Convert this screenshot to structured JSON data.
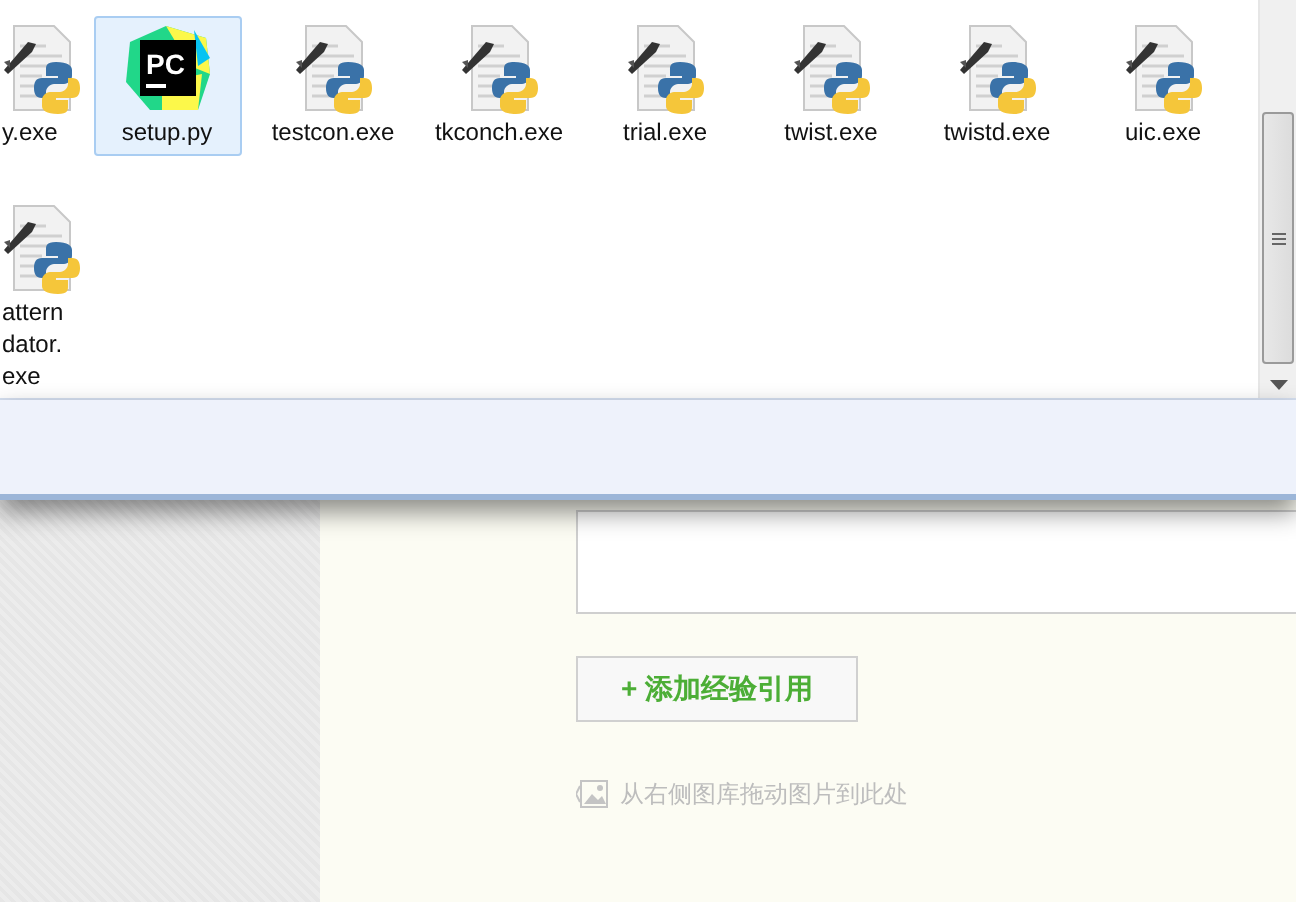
{
  "explorer": {
    "files": [
      {
        "name": "y.exe",
        "kind": "python-exe",
        "selected": false
      },
      {
        "name": "setup.py",
        "kind": "pycharm",
        "icon_text": "PC",
        "selected": true
      },
      {
        "name": "testcon.exe",
        "kind": "python-exe",
        "selected": false
      },
      {
        "name": "tkconch.exe",
        "kind": "python-exe",
        "selected": false
      },
      {
        "name": "trial.exe",
        "kind": "python-exe",
        "selected": false
      },
      {
        "name": "twist.exe",
        "kind": "python-exe",
        "selected": false
      },
      {
        "name": "twistd.exe",
        "kind": "python-exe",
        "selected": false
      },
      {
        "name": "uic.exe",
        "kind": "python-exe",
        "selected": false
      },
      {
        "name": "attern\ndator.\nexe",
        "kind": "python-exe",
        "selected": false
      }
    ]
  },
  "editor": {
    "add_reference_button": "+ 添加经验引用",
    "image_drop_hint": "从右侧图库拖动图片到此处"
  }
}
